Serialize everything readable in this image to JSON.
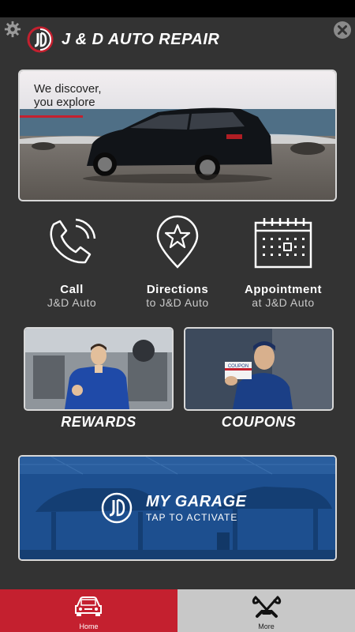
{
  "app": {
    "title": "J & D AUTO REPAIR"
  },
  "hero": {
    "line1": "We discover,",
    "line2": "you explore"
  },
  "actions": [
    {
      "title": "Call",
      "subtitle": "J&D Auto",
      "icon": "phone-icon"
    },
    {
      "title": "Directions",
      "subtitle": "to J&D Auto",
      "icon": "map-pin-star-icon"
    },
    {
      "title": "Appointment",
      "subtitle": "at J&D Auto",
      "icon": "calendar-icon"
    }
  ],
  "cards": {
    "rewards": "REWARDS",
    "coupons": "COUPONS",
    "coupon_tag": "COUPON"
  },
  "garage": {
    "title": "MY GARAGE",
    "subtitle": "TAP TO ACTIVATE"
  },
  "tabs": [
    {
      "label": "Home",
      "icon": "car-icon"
    },
    {
      "label": "More",
      "icon": "tools-icon"
    }
  ],
  "colors": {
    "accent": "#c4202f",
    "background": "#333333",
    "garage_blue": "#1d4f8f"
  }
}
